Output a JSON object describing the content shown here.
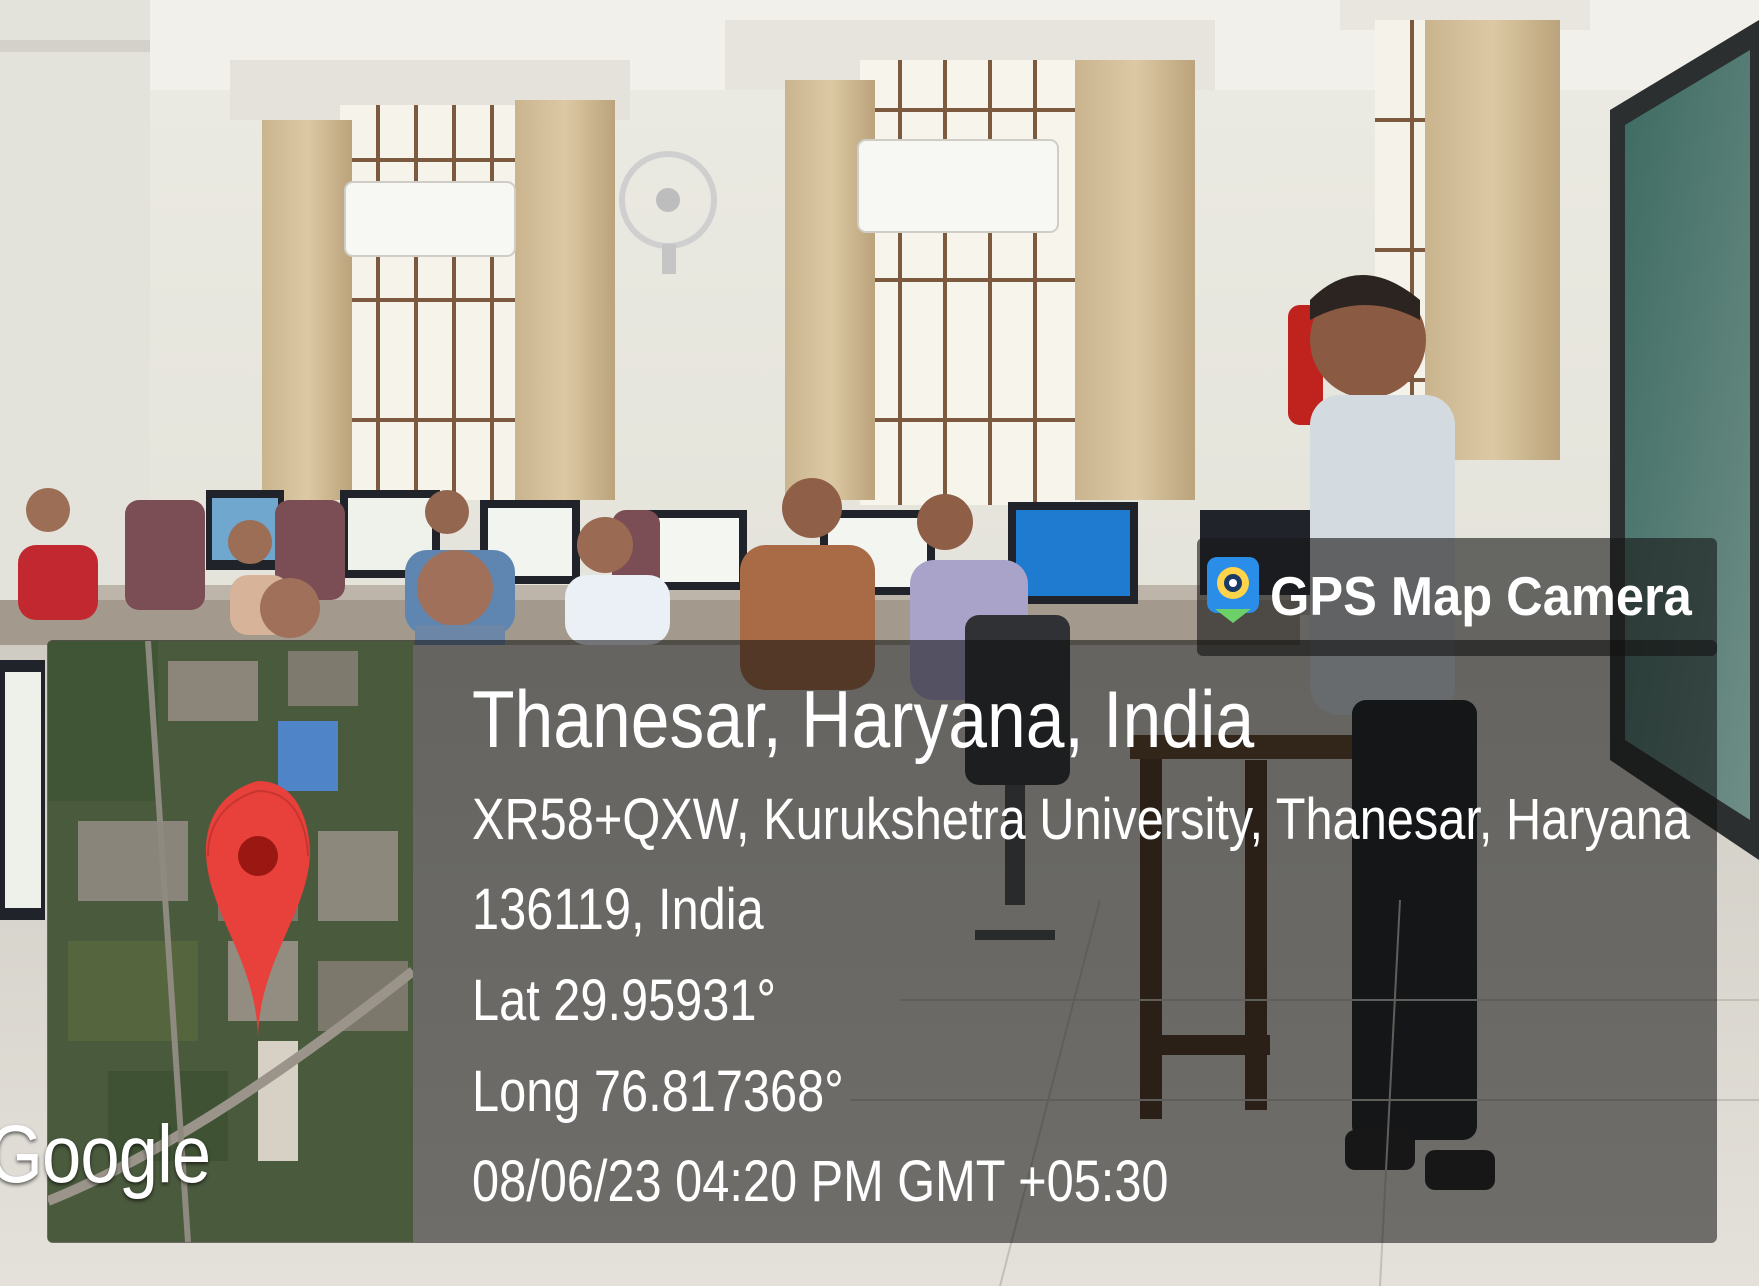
{
  "overlay": {
    "app_name": "GPS Map Camera",
    "map_label": "Google",
    "location_title": "Thanesar, Haryana, India",
    "address_line_1": "XR58+QXW, Kurukshetra University, Thanesar, Haryana",
    "address_line_2": "136119, India",
    "latitude": "Lat 29.95931°",
    "longitude": "Long 76.817368°",
    "datetime": "08/06/23 04:20 PM GMT +05:30"
  },
  "colors": {
    "map_pin": "#e8403a",
    "badge_icon": "#2a8ee8",
    "overlay_text": "#ffffff"
  }
}
